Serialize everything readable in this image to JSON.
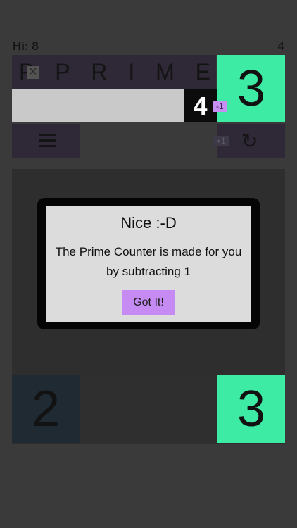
{
  "hud": {
    "hi_label": "Hi: 8",
    "score": "4"
  },
  "title": {
    "letters": [
      "P",
      "P",
      "R",
      "I",
      "M",
      "E"
    ],
    "x_mark": "✕"
  },
  "top_tile": {
    "value": "3",
    "color": "#3deba5"
  },
  "current": {
    "value": "4",
    "minus_badge": "-1",
    "plus_badge": "+1"
  },
  "controls": {
    "menu_icon": "hamburger-icon",
    "restart_icon": "↻"
  },
  "board": {
    "bottom_left_tile": "2",
    "bottom_right_tile": "3"
  },
  "modal": {
    "title": "Nice :-D",
    "body": "The Prime Counter is made for you by subtracting 1",
    "button": "Got It!"
  }
}
